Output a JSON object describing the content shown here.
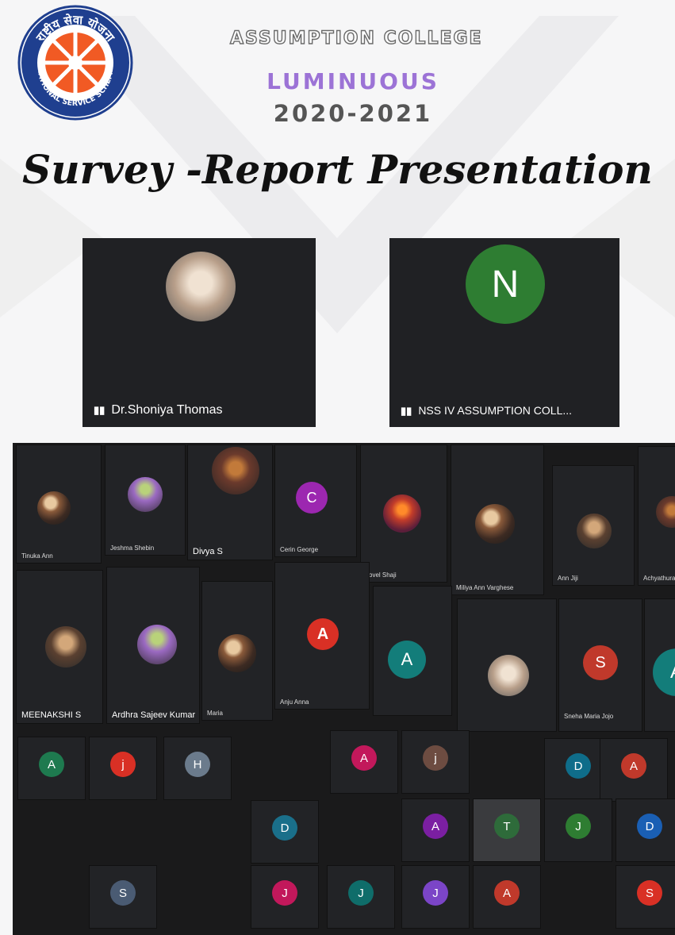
{
  "header": {
    "college": "ASSUMPTION COLLEGE",
    "event": "LUMINUOUS",
    "years": "2020-2021",
    "title": "Survey -Report Presentation",
    "logo_top_text": "राष्ट्रीय सेवा योजना",
    "logo_bottom_text": "NATIONAL SERVICE SCHEME"
  },
  "hosts": [
    {
      "name": "Dr.Shoniya Thomas",
      "avatar": "photo"
    },
    {
      "name": "NSS IV ASSUMPTION COLL...",
      "avatar_letter": "N"
    }
  ],
  "participants": {
    "row1": [
      {
        "name": "Tinuka Ann",
        "avatar": "photo"
      },
      {
        "name": "Jeshma Shebin",
        "avatar": "photo"
      },
      {
        "name": "Divya S",
        "avatar": "photo"
      },
      {
        "name": "Cerin George",
        "avatar_letter": "C"
      },
      {
        "name": "Jovel Shaji",
        "avatar": "photo"
      },
      {
        "name": "Miliya Ann Varghese",
        "avatar": "photo"
      },
      {
        "name": "Ann Jiji",
        "avatar": "photo"
      },
      {
        "name": "Achyathuratt",
        "avatar": "photo"
      }
    ],
    "row2": [
      {
        "name": "MEENAKSHI S",
        "avatar": "photo"
      },
      {
        "name": "Ardhra Sajeev Kumar",
        "avatar": "photo"
      },
      {
        "name": "Maria",
        "avatar": "photo"
      },
      {
        "name": "Anju Anna",
        "avatar_letter": "A"
      },
      {
        "name": "",
        "avatar_letter": "A"
      },
      {
        "name": "",
        "avatar": "photo"
      },
      {
        "name": "Sneha Maria Jojo",
        "avatar_letter": "S"
      },
      {
        "name": "",
        "avatar_letter": "A"
      }
    ],
    "small_letters": [
      "A",
      "j",
      "H",
      "A",
      "j",
      "D",
      "A",
      "D",
      "A",
      "T",
      "J",
      "D",
      "J",
      "S",
      "J",
      "J",
      "A",
      "S"
    ]
  },
  "colors": {
    "meet_bg": "#202124",
    "purple": "#9c73d6",
    "logo_orange": "#f15a24",
    "logo_blue": "#1f3f8f"
  }
}
